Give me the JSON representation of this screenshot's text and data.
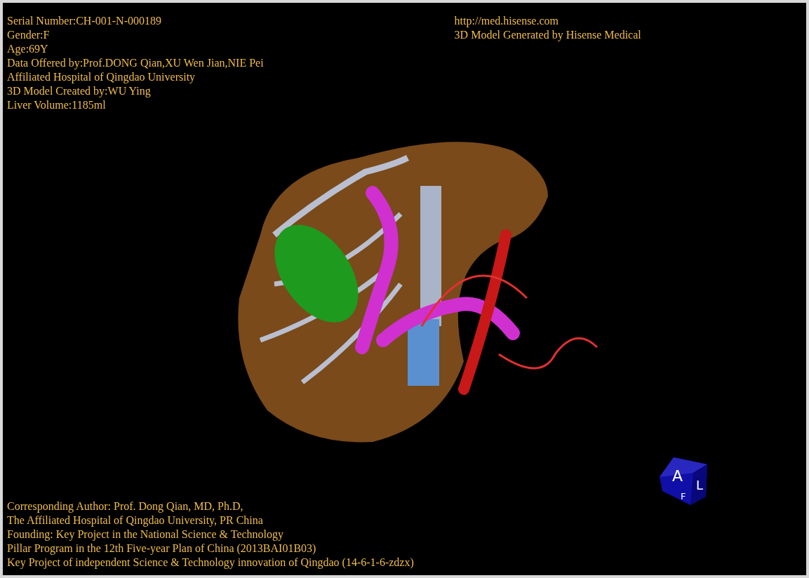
{
  "info_top_left": [
    "Serial Number:CH-001-N-000189",
    "Gender:F",
    "Age:69Y",
    "Data Offered by:Prof.DONG Qian,XU Wen Jian,NIE Pei",
    "Affiliated Hospital of Qingdao University",
    "3D Model Created by:WU Ying",
    "Liver Volume:1185ml"
  ],
  "info_top_right": [
    "http://med.hisense.com",
    "3D Model Generated by Hisense Medical"
  ],
  "viewport": {
    "kind": "picture"
  },
  "orientation_cube": {
    "labels": [
      "A",
      "L",
      "F"
    ]
  },
  "info_bottom_left": [
    "Corresponding Author: Prof. Dong Qian, MD, Ph.D,",
    "The Affiliated Hospital of Qingdao University, PR China",
    "Founding: Key Project in the National Science & Technology",
    "Pillar Program in the 12th Five-year Plan of China (2013BAI01B03)",
    "Key Project of independent Science & Technology innovation of Qingdao (14-6-1-6-zdzx)"
  ]
}
